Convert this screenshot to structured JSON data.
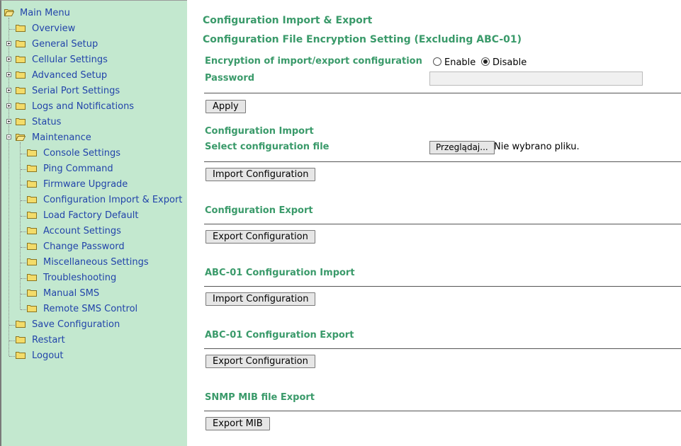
{
  "sidebar": {
    "root": "Main Menu",
    "items": [
      {
        "label": "Overview"
      },
      {
        "label": "General Setup"
      },
      {
        "label": "Cellular Settings"
      },
      {
        "label": "Advanced Setup"
      },
      {
        "label": "Serial Port Settings"
      },
      {
        "label": "Logs and Notifications"
      },
      {
        "label": "Status"
      },
      {
        "label": "Maintenance"
      },
      {
        "label": "Save Configuration"
      },
      {
        "label": "Restart"
      },
      {
        "label": "Logout"
      }
    ],
    "maintenance_children": [
      {
        "label": "Console Settings"
      },
      {
        "label": "Ping Command"
      },
      {
        "label": "Firmware Upgrade"
      },
      {
        "label": "Configuration Import & Export"
      },
      {
        "label": "Load Factory Default"
      },
      {
        "label": "Account Settings"
      },
      {
        "label": "Change Password"
      },
      {
        "label": "Miscellaneous Settings"
      },
      {
        "label": "Troubleshooting"
      },
      {
        "label": "Manual SMS"
      },
      {
        "label": "Remote SMS Control"
      }
    ]
  },
  "main": {
    "page_title": "Configuration Import & Export",
    "encryption_title": "Configuration File Encryption Setting (Excluding ABC-01)",
    "encryption_label": "Encryption of import/export configuration",
    "enable_label": "Enable",
    "disable_label": "Disable",
    "password_label": "Password",
    "apply_button": "Apply",
    "import_title": "Configuration Import",
    "select_file_label": "Select configuration file",
    "browse_button": "Przeglądaj...",
    "no_file_text": "Nie wybrano pliku.",
    "import_button": "Import Configuration",
    "export_title": "Configuration Export",
    "export_button": "Export Configuration",
    "abc_import_title": "ABC-01 Configuration Import",
    "abc_import_button": "Import Configuration",
    "abc_export_title": "ABC-01 Configuration Export",
    "abc_export_button": "Export Configuration",
    "snmp_title": "SNMP MIB file Export",
    "snmp_button": "Export MIB"
  },
  "colors": {
    "sidebar_bg": "#c3e8cf",
    "heading": "#3a9a6a",
    "link": "#2244aa"
  }
}
